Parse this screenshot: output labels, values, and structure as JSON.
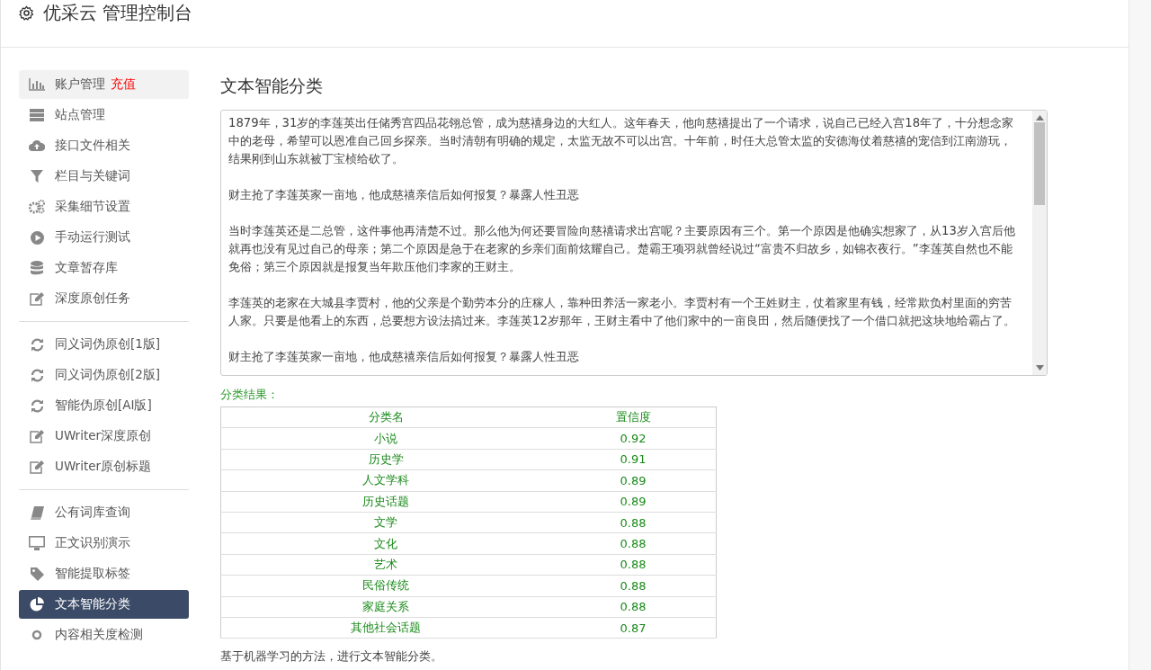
{
  "header": {
    "title": "优采云 管理控制台"
  },
  "sidebar": {
    "groups": [
      {
        "items": [
          {
            "label": "账户管理",
            "badge": "充值",
            "highlighted": true,
            "selected": false
          },
          {
            "label": "站点管理",
            "highlighted": false,
            "selected": false
          },
          {
            "label": "接口文件相关",
            "highlighted": false,
            "selected": false
          },
          {
            "label": "栏目与关键词",
            "highlighted": false,
            "selected": false
          },
          {
            "label": "采集细节设置",
            "highlighted": false,
            "selected": false
          },
          {
            "label": "手动运行测试",
            "highlighted": false,
            "selected": false
          },
          {
            "label": "文章暂存库",
            "highlighted": false,
            "selected": false
          },
          {
            "label": "深度原创任务",
            "highlighted": false,
            "selected": false
          }
        ]
      },
      {
        "items": [
          {
            "label": "同义词伪原创[1版]",
            "highlighted": false,
            "selected": false
          },
          {
            "label": "同义词伪原创[2版]",
            "highlighted": false,
            "selected": false
          },
          {
            "label": "智能伪原创[AI版]",
            "highlighted": false,
            "selected": false
          },
          {
            "label": "UWriter深度原创",
            "highlighted": false,
            "selected": false
          },
          {
            "label": "UWriter原创标题",
            "highlighted": false,
            "selected": false
          }
        ]
      },
      {
        "items": [
          {
            "label": "公有词库查询",
            "highlighted": false,
            "selected": false
          },
          {
            "label": "正文识别演示",
            "highlighted": false,
            "selected": false
          },
          {
            "label": "智能提取标签",
            "highlighted": false,
            "selected": false
          },
          {
            "label": "文本智能分类",
            "highlighted": false,
            "selected": true
          },
          {
            "label": "内容相关度检测",
            "highlighted": false,
            "selected": false
          }
        ]
      }
    ]
  },
  "main": {
    "title": "文本智能分类",
    "text_paragraphs": [
      "1879年，31岁的李莲英出任储秀宫四品花翎总管，成为慈禧身边的大红人。这年春天，他向慈禧提出了一个请求，说自己已经入宫18年了，十分想念家中的老母，希望可以恩准自己回乡探亲。当时清朝有明确的规定，太监无故不可以出宫。十年前，时任大总管太监的安德海仗着慈禧的宠信到江南游玩，结果刚到山东就被丁宝桢给砍了。",
      "财主抢了李莲英家一亩地，他成慈禧亲信后如何报复？暴露人性丑恶",
      "当时李莲英还是二总管，这件事他再清楚不过。那么他为何还要冒险向慈禧请求出宫呢？主要原因有三个。第一个原因是他确实想家了，从13岁入宫后他就再也没有见过自己的母亲；第二个原因是急于在老家的乡亲们面前炫耀自己。楚霸王项羽就曾经说过“富贵不归故乡，如锦衣夜行。”李莲英自然也不能免俗；第三个原因就是报复当年欺压他们李家的王财主。",
      "李莲英的老家在大城县李贾村，他的父亲是个勤劳本分的庄稼人，靠种田养活一家老小。李贾村有一个王姓财主，仗着家里有钱，经常欺负村里面的穷苦人家。只要是他看上的东西，总要想方设法搞过来。李莲英12岁那年，王财主看中了他们家中的一亩良田，然后随便找了一个借口就把这块地给霸占了。",
      "财主抢了李莲英家一亩地，他成慈禧亲信后如何报复？暴露人性丑恶"
    ],
    "result_label": "分类结果：",
    "table": {
      "columns": [
        "分类名",
        "置信度"
      ],
      "rows": [
        [
          "小说",
          "0.92"
        ],
        [
          "历史学",
          "0.91"
        ],
        [
          "人文学科",
          "0.89"
        ],
        [
          "历史话题",
          "0.89"
        ],
        [
          "文学",
          "0.88"
        ],
        [
          "文化",
          "0.88"
        ],
        [
          "艺术",
          "0.88"
        ],
        [
          "民俗传统",
          "0.88"
        ],
        [
          "家庭关系",
          "0.88"
        ],
        [
          "其他社会话题",
          "0.87"
        ]
      ]
    },
    "footnote": "基于机器学习的方法，进行文本智能分类。"
  }
}
